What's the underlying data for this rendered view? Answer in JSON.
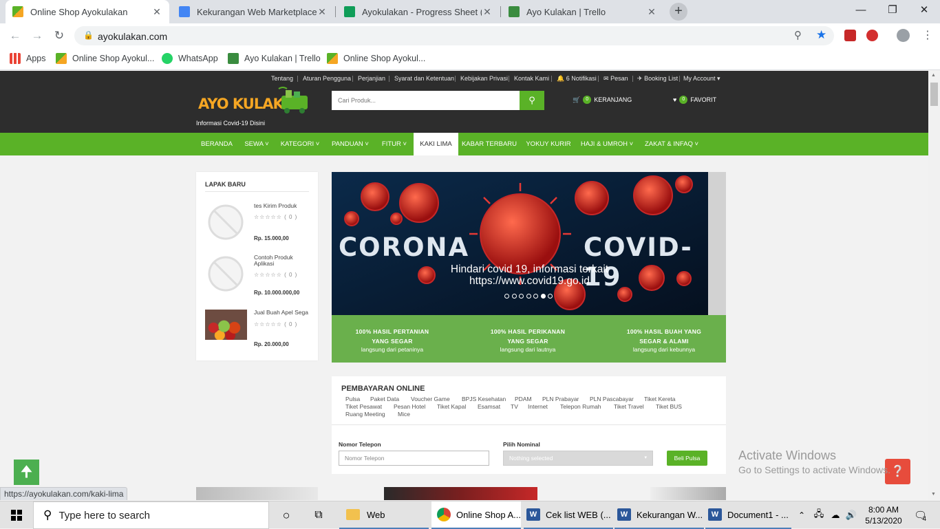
{
  "browser": {
    "tabs": [
      {
        "title": "Online Shop Ayokulakan",
        "active": true,
        "icon": "ayokulakan-favicon"
      },
      {
        "title": "Kekurangan Web Marketplace A",
        "active": false,
        "icon": "google-docs-icon"
      },
      {
        "title": "Ayokulakan - Progress Sheet (Yu",
        "active": false,
        "icon": "google-sheets-icon"
      },
      {
        "title": "Ayo Kulakan | Trello",
        "active": false,
        "icon": "trello-icon"
      }
    ],
    "url": "ayokulakan.com",
    "bookmarks": [
      {
        "label": "Apps",
        "icon": "apps-grid-icon"
      },
      {
        "label": "Online Shop Ayokul...",
        "icon": "ayokulakan-favicon"
      },
      {
        "label": "WhatsApp",
        "icon": "whatsapp-icon"
      },
      {
        "label": "Ayo Kulakan | Trello",
        "icon": "trello-icon"
      },
      {
        "label": "Online Shop Ayokul...",
        "icon": "ayokulakan-favicon"
      }
    ],
    "status_url": "https://ayokulakan.com/kaki-lima"
  },
  "header": {
    "top_links": [
      "Tentang",
      "Aturan Pengguna",
      "Perjanjian",
      "Syarat dan Ketentuan",
      "Kebijakan Privasi",
      "Kontak Kami",
      "6 Notifikasi",
      "Pesan",
      "Booking List",
      "My Account"
    ],
    "logo_text": "AYO KULAKAN",
    "covid_link": "Informasi Covid-19 Disini",
    "search_placeholder": "Cari Produk...",
    "cart_label": "KERANJANG",
    "cart_count": "0",
    "fav_label": "FAVORIT",
    "fav_count": "0"
  },
  "nav": [
    "BERANDA",
    "SEWA",
    "KATEGORI",
    "PANDUAN",
    "FITUR",
    "KAKI LIMA",
    "KABAR TERBARU",
    "YOKUY KURIR",
    "HAJI & UMROH",
    "ZAKAT & INFAQ"
  ],
  "lapak": {
    "title": "LAPAK BARU",
    "items": [
      {
        "name": "tes Kirim Produk",
        "rating": "( 0 )",
        "price": "Rp. 15.000,00"
      },
      {
        "name": "Contoh Produk Aplikasi",
        "rating": "( 0 )",
        "price": "Rp. 10.000.000,00"
      },
      {
        "name": "Jual Buah Apel Sega",
        "rating": "( 0 )",
        "price": "Rp. 20.000,00"
      }
    ]
  },
  "banner": {
    "word_left": "CORONA",
    "word_right": "COVID-19",
    "caption_1": "Hindari covid 19, informasi terkait",
    "caption_2": "https://www.covid19.go.id",
    "slide_count": 7,
    "active_slide": 6
  },
  "promo": [
    {
      "h1": "100% HASIL PERTANIAN",
      "h2": "YANG SEGAR",
      "sub": "langsung dari petaninya"
    },
    {
      "h1": "100% HASIL PERIKANAN",
      "h2": "YANG SEGAR",
      "sub": "langsung dari lautnya"
    },
    {
      "h1": "100% HASIL BUAH YANG",
      "h2": "SEGAR & ALAMI",
      "sub": "langsung dari kebunnya"
    }
  ],
  "payment": {
    "title": "PEMBAYARAN ONLINE",
    "services": [
      "Pulsa",
      "Paket Data",
      "Voucher Game",
      "BPJS Kesehatan",
      "PDAM",
      "PLN Prabayar",
      "PLN Pascabayar",
      "Tiket Kereta",
      "Tiket Pesawat",
      "Pesan Hotel",
      "Tiket Kapal",
      "Esamsat",
      "TV",
      "Internet",
      "Telepon Rumah",
      "Tiket Travel",
      "Tiket BUS",
      "Ruang Meeting",
      "Mice"
    ],
    "phone_label": "Nomor Telepon",
    "phone_placeholder": "Nomor Telepon",
    "nominal_label": "Pilih Nominal",
    "nominal_value": "Nothing selected",
    "buy_label": "Beli Pulsa"
  },
  "watermark": {
    "line1": "Activate Windows",
    "line2": "Go to Settings to activate Windows."
  },
  "taskbar": {
    "search_placeholder": "Type here to search",
    "apps": [
      {
        "label": "Web"
      },
      {
        "label": "Online Shop A..."
      },
      {
        "label": "Cek list WEB (..."
      },
      {
        "label": "Kekurangan W..."
      },
      {
        "label": "Document1 - ..."
      }
    ],
    "time": "8:00 AM",
    "date": "5/13/2020",
    "notifications": "4"
  },
  "colors": {
    "brand_green": "#5ab227",
    "header_dark": "#2d2d2d",
    "promo_green": "#6ab04c",
    "logo_orange": "#f5a623"
  }
}
